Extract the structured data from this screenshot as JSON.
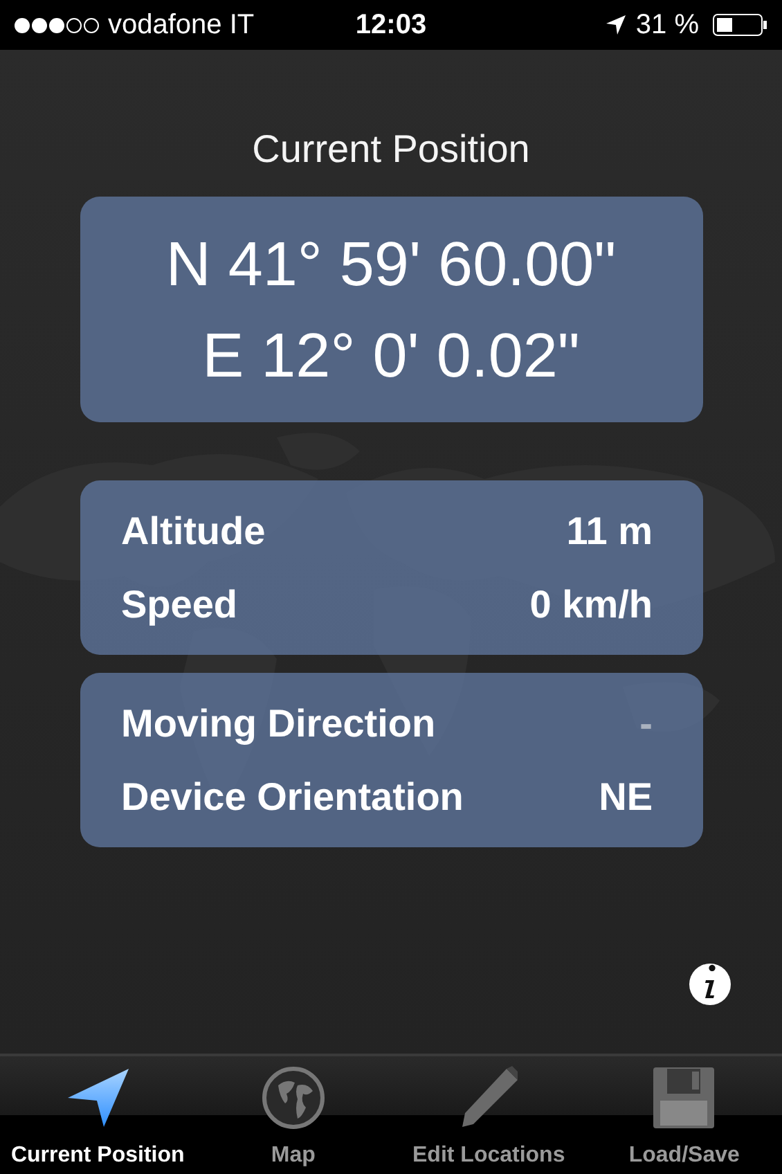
{
  "status_bar": {
    "carrier": "vodafone IT",
    "time": "12:03",
    "battery": "31 %"
  },
  "title": "Current Position",
  "coordinates": [
    "N 41° 59' 60.00\"",
    "E 12° 0' 0.02\""
  ],
  "panels": [
    {
      "rows": [
        {
          "label": "Altitude",
          "value": "11 m",
          "available": true
        },
        {
          "label": "Speed",
          "value": "0 km/h",
          "available": true
        }
      ]
    },
    {
      "rows": [
        {
          "label": "Moving Direction",
          "value": "-",
          "available": false
        },
        {
          "label": "Device Orientation",
          "value": "NE",
          "available": true
        }
      ]
    }
  ],
  "tabs": [
    {
      "label": "Current Position",
      "kind": "position",
      "selected": true
    },
    {
      "label": "Map",
      "kind": "map",
      "selected": false
    },
    {
      "label": "Edit Locations",
      "kind": "edit",
      "selected": false
    },
    {
      "label": "Load/Save",
      "kind": "storage",
      "selected": false
    }
  ]
}
